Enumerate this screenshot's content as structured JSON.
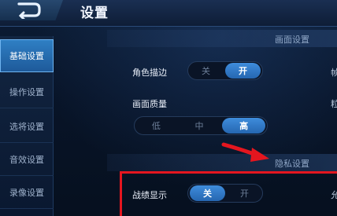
{
  "header": {
    "title": "设置"
  },
  "sidebar": {
    "items": [
      {
        "label": "基础设置",
        "active": true
      },
      {
        "label": "操作设置",
        "active": false
      },
      {
        "label": "选将设置",
        "active": false
      },
      {
        "label": "音效设置",
        "active": false
      },
      {
        "label": "录像设置",
        "active": false
      }
    ]
  },
  "sections": {
    "display": {
      "title": "画面设置",
      "outline": {
        "label": "角色描边",
        "off": "关",
        "on": "开",
        "selected": "开"
      },
      "quality": {
        "label": "画面质量",
        "low": "低",
        "mid": "中",
        "high": "高",
        "selected": "高"
      },
      "right_edge_top": "帧",
      "right_edge_mid": "粒"
    },
    "privacy": {
      "title": "隐私设置",
      "record_display": {
        "label": "战绩显示",
        "off": "关",
        "on": "开",
        "selected": "关"
      },
      "right_edge": "允"
    }
  },
  "colors": {
    "accent": "#2f7fc4",
    "highlight_box": "#e4161f",
    "background": "#071326"
  },
  "icons": {
    "back": "back-arrow-icon",
    "annotation": "red-arrow-icon"
  }
}
